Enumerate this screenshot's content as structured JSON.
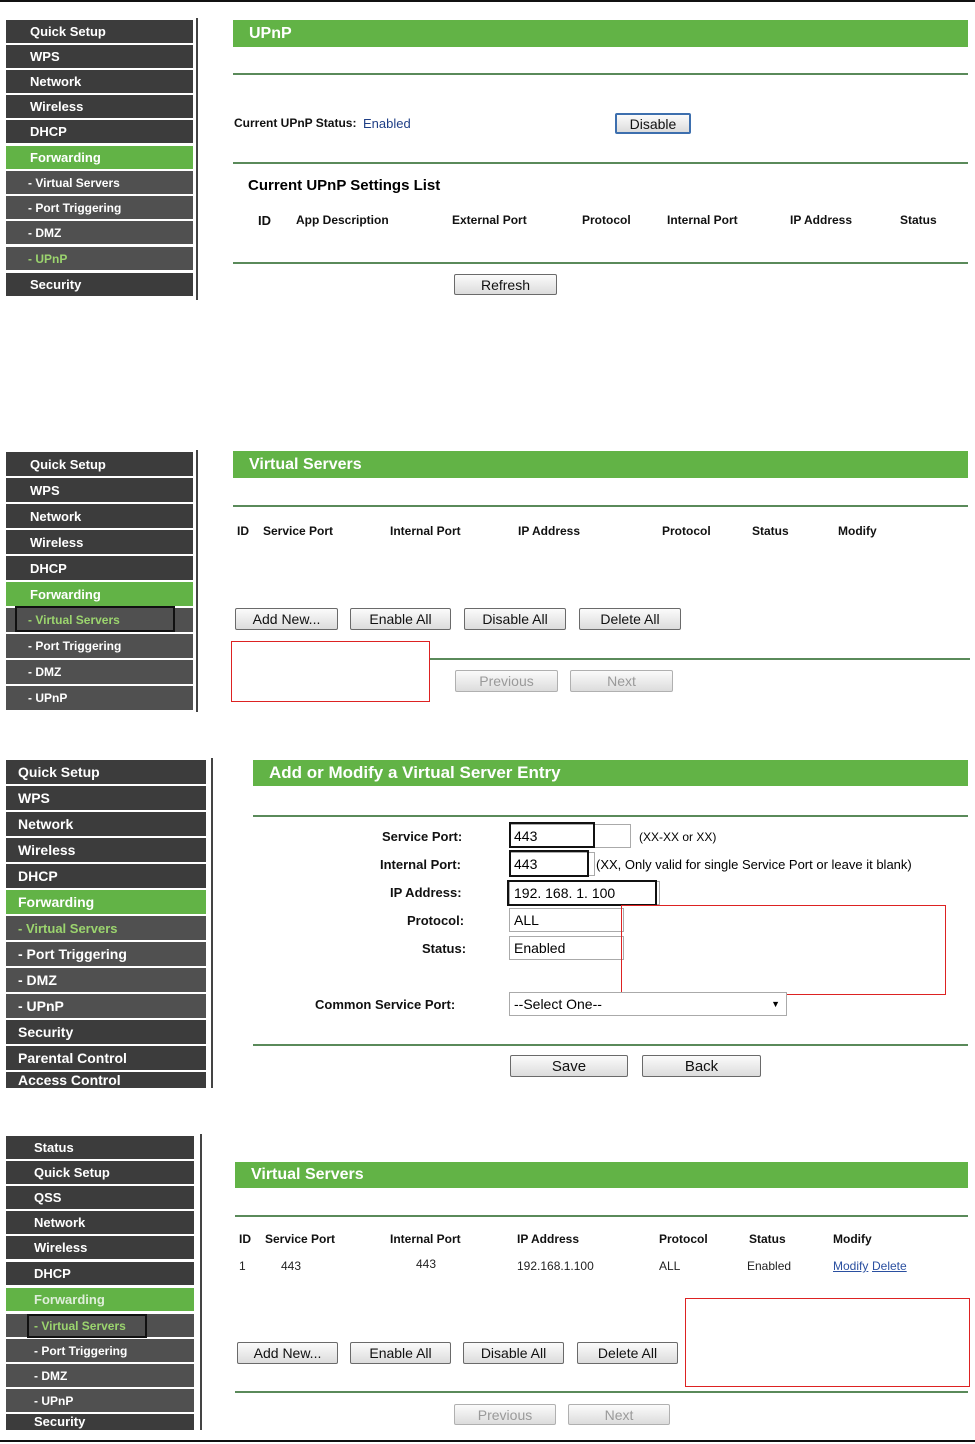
{
  "panel1": {
    "sidebar": [
      "Quick Setup",
      "WPS",
      "Network",
      "Wireless",
      "DHCP",
      "Forwarding",
      "- Virtual Servers",
      "- Port Triggering",
      "- DMZ",
      "- UPnP",
      "Security"
    ],
    "title": "UPnP",
    "status_label": "Current UPnP Status:",
    "status_value": "Enabled",
    "disable_button": "Disable",
    "list_title": "Current UPnP Settings List",
    "columns": [
      "ID",
      "App Description",
      "External Port",
      "Protocol",
      "Internal Port",
      "IP Address",
      "Status"
    ],
    "refresh_button": "Refresh"
  },
  "panel2": {
    "sidebar": [
      "Quick Setup",
      "WPS",
      "Network",
      "Wireless",
      "DHCP",
      "Forwarding",
      "- Virtual Servers",
      "- Port Triggering",
      "- DMZ",
      "- UPnP"
    ],
    "title": "Virtual Servers",
    "columns": [
      "ID",
      "Service Port",
      "Internal Port",
      "IP Address",
      "Protocol",
      "Status",
      "Modify"
    ],
    "buttons": [
      "Add New...",
      "Enable All",
      "Disable All",
      "Delete All"
    ],
    "previous": "Previous",
    "next": "Next"
  },
  "panel3": {
    "sidebar": [
      "Quick Setup",
      "WPS",
      "Network",
      "Wireless",
      "DHCP",
      "Forwarding",
      "- Virtual Servers",
      "- Port Triggering",
      "- DMZ",
      "- UPnP",
      "Security",
      "Parental Control",
      "Access Control"
    ],
    "title": "Add or Modify a Virtual Server Entry",
    "service_port_label": "Service Port:",
    "service_port_value": "443",
    "service_port_hint": "(XX-XX or XX)",
    "internal_port_label": "Internal Port:",
    "internal_port_value": "443",
    "internal_port_hint": "(XX, Only valid for single Service Port or leave it blank)",
    "ip_label": "IP Address:",
    "ip_value": "192. 168. 1. 100",
    "protocol_label": "Protocol:",
    "protocol_value": "ALL",
    "status_label": "Status:",
    "status_value": "Enabled",
    "common_label": "Common Service Port:",
    "common_value": "--Select One--",
    "save": "Save",
    "back": "Back"
  },
  "panel4": {
    "sidebar": [
      "Status",
      "Quick Setup",
      "QSS",
      "Network",
      "Wireless",
      "DHCP",
      "Forwarding",
      "- Virtual Servers",
      "- Port Triggering",
      "- DMZ",
      "- UPnP",
      "Security"
    ],
    "title": "Virtual Servers",
    "columns": [
      "ID",
      "Service Port",
      "Internal Port",
      "IP Address",
      "Protocol",
      "Status",
      "Modify"
    ],
    "row": {
      "id": "1",
      "service_port": "443",
      "internal_port": "443",
      "ip": "192.168.1.100",
      "protocol": "ALL",
      "status": "Enabled",
      "modify": "Modify",
      "delete": "Delete"
    },
    "buttons": [
      "Add New...",
      "Enable All",
      "Disable All",
      "Delete All"
    ],
    "previous": "Previous",
    "next": "Next"
  }
}
